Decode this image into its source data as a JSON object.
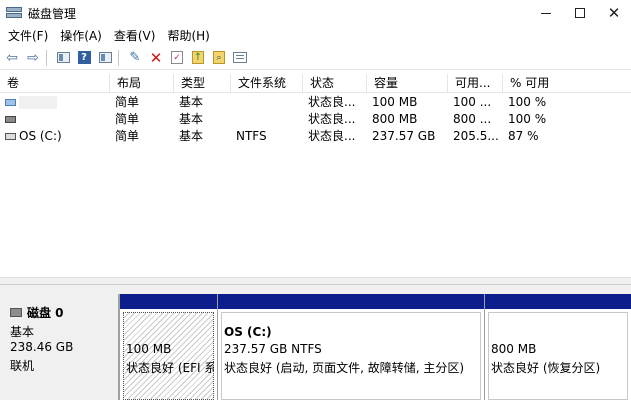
{
  "window": {
    "title": "磁盘管理"
  },
  "menu": [
    {
      "label": "文件(F)"
    },
    {
      "label": "操作(A)"
    },
    {
      "label": "查看(V)"
    },
    {
      "label": "帮助(H)"
    }
  ],
  "toolbar": {
    "icons": [
      "back-arrow-icon",
      "forward-arrow-icon",
      "console-tree-icon",
      "help-icon",
      "properties-pane-icon",
      "connect-icon",
      "delete-icon",
      "checklist-icon",
      "folder-up-icon",
      "folder-search-icon",
      "list-view-icon"
    ]
  },
  "volume_table": {
    "headers": [
      "卷",
      "布局",
      "类型",
      "文件系统",
      "状态",
      "容量",
      "可用...",
      "% 可用"
    ],
    "rows": [
      {
        "volume": "",
        "layout": "简单",
        "type": "基本",
        "fs": "",
        "status": "状态良...",
        "capacity": "100 MB",
        "free": "100 ...",
        "pct_free": "100 %"
      },
      {
        "volume": "",
        "layout": "简单",
        "type": "基本",
        "fs": "",
        "status": "状态良...",
        "capacity": "800 MB",
        "free": "800 ...",
        "pct_free": "100 %"
      },
      {
        "volume": "OS (C:)",
        "layout": "简单",
        "type": "基本",
        "fs": "NTFS",
        "status": "状态良...",
        "capacity": "237.57 GB",
        "free": "205.5...",
        "pct_free": "87 %"
      }
    ]
  },
  "disk": {
    "name": "磁盘 0",
    "type": "基本",
    "size": "238.46 GB",
    "status": "联机",
    "partitions": [
      {
        "title": "",
        "size": "100 MB",
        "status": "状态良好 (EFI 系"
      },
      {
        "title": "OS  (C:)",
        "size": "237.57 GB NTFS",
        "status": "状态良好 (启动, 页面文件, 故障转储, 主分区)"
      },
      {
        "title": "",
        "size": "800 MB",
        "status": "状态良好 (恢复分区)"
      }
    ]
  },
  "colors": {
    "partition_band": "#0b1e8c"
  }
}
